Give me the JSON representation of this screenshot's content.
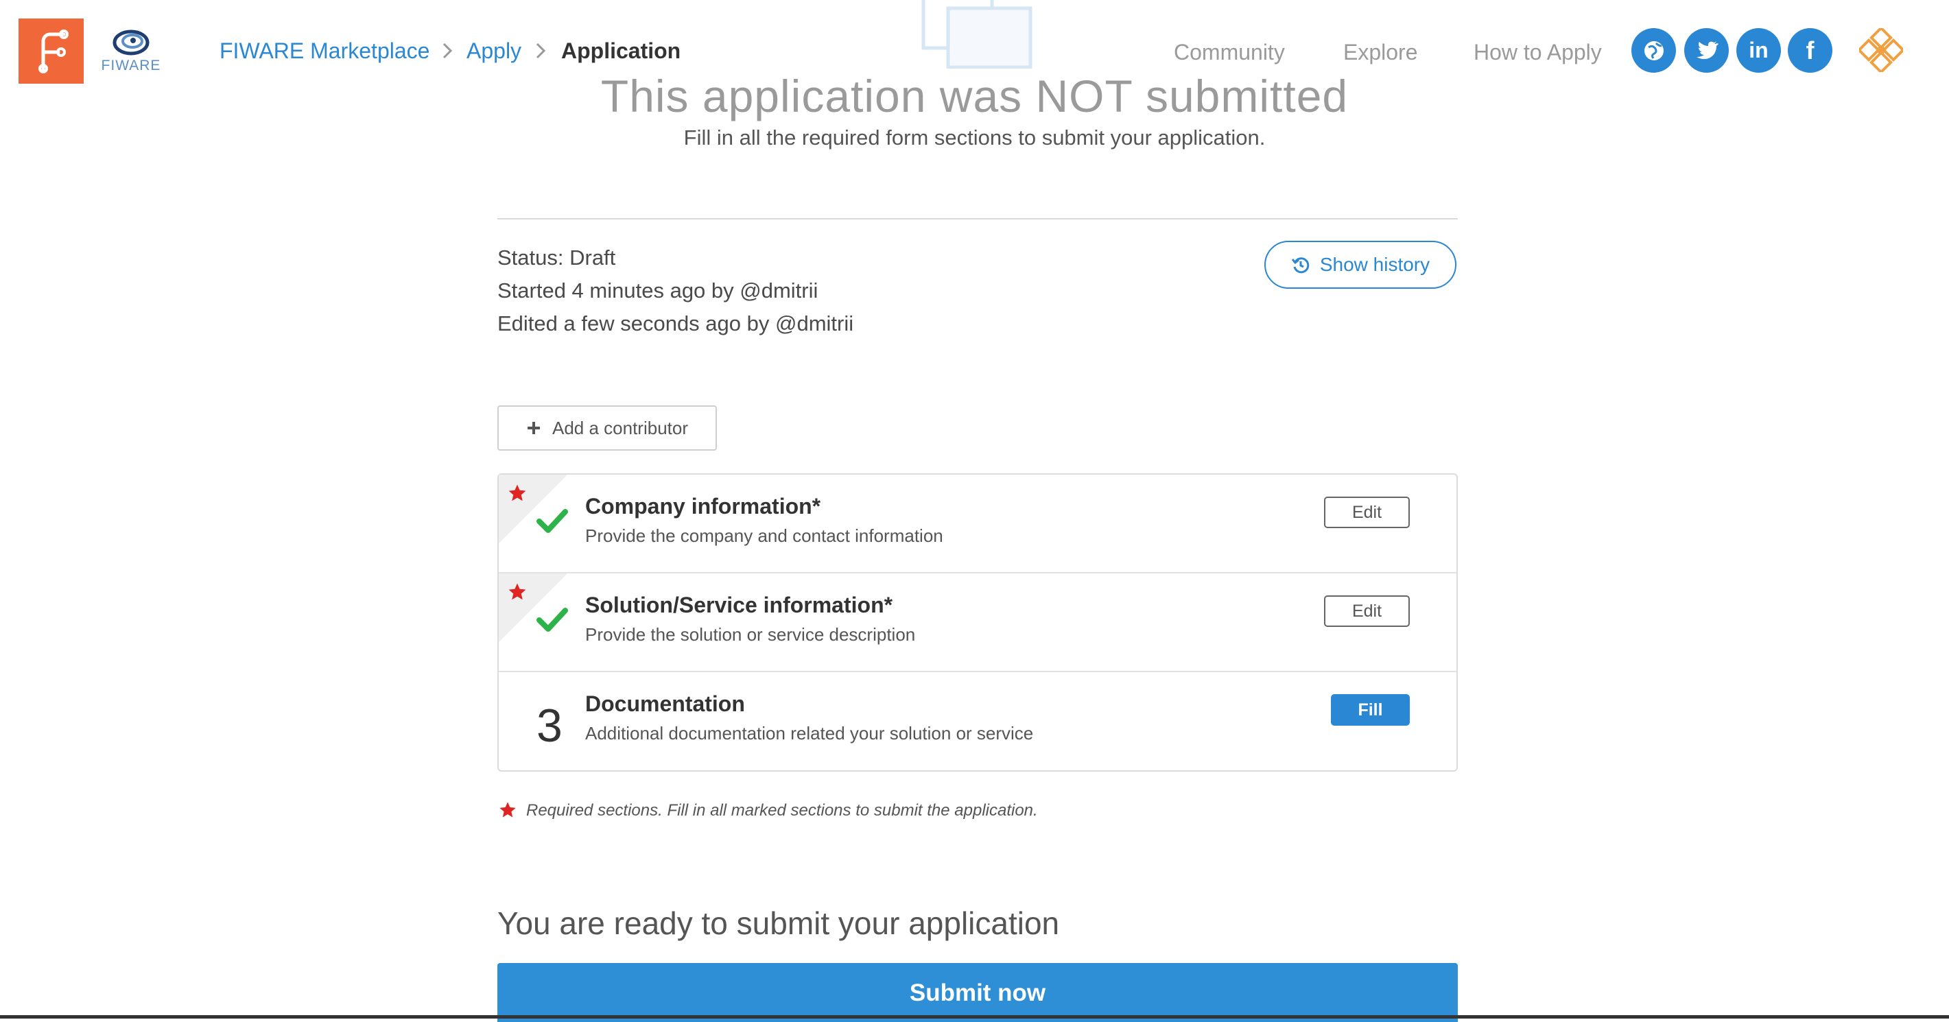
{
  "header": {
    "breadcrumb": [
      "FIWARE Marketplace",
      "Apply",
      "Application"
    ],
    "fiware_logo_text": "FIWARE",
    "nav": [
      "Community",
      "Explore",
      "How to Apply"
    ],
    "social_icons": [
      "globe-icon",
      "twitter-icon",
      "linkedin-icon",
      "facebook-icon"
    ]
  },
  "title": "This application was NOT submitted",
  "subtitle": "Fill in all the required form sections to submit your application.",
  "status": {
    "status_line": "Status: Draft",
    "started_line": "Started 4 minutes ago by @dmitrii",
    "edited_line": "Edited a few seconds ago by @dmitrii"
  },
  "history_button": "Show history",
  "contributor_button": "Add a contributor",
  "sections": [
    {
      "title": "Company information*",
      "description": "Provide the company and contact information",
      "button": "Edit",
      "required": true,
      "complete": true
    },
    {
      "title": "Solution/Service information*",
      "description": "Provide the solution or service description",
      "button": "Edit",
      "required": true,
      "complete": true
    },
    {
      "number": "3",
      "title": "Documentation",
      "description": "Additional documentation related your solution or service",
      "button": "Fill",
      "required": false,
      "complete": false
    }
  ],
  "required_note": "Required sections. Fill in all marked sections to submit the application.",
  "ready_text": "You are ready to submit your application",
  "submit_button": "Submit now",
  "colors": {
    "accent": "#2a87d4",
    "brand_orange": "#f0683a",
    "check_green": "#2db34a",
    "required_red": "#e02424"
  }
}
